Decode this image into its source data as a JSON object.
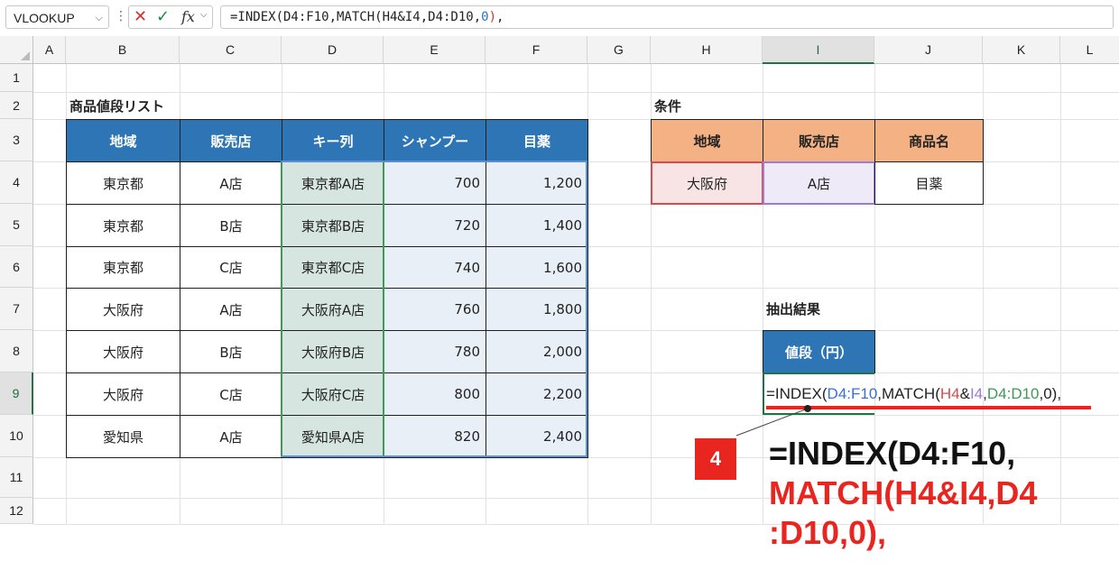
{
  "formula_bar": {
    "name_box": "VLOOKUP",
    "cancel_icon": "✕",
    "enter_icon": "✓",
    "fx_label": "fx",
    "formula_black": "=INDEX(D4:F10,MATCH(H4&I4,D4:D10,",
    "formula_blue": "0",
    "formula_red": ")",
    "formula_tail": ","
  },
  "columns": [
    "A",
    "B",
    "C",
    "D",
    "E",
    "F",
    "G",
    "H",
    "I",
    "J",
    "K",
    "L"
  ],
  "rows": [
    "1",
    "2",
    "3",
    "4",
    "5",
    "6",
    "7",
    "8",
    "9",
    "10",
    "11",
    "12"
  ],
  "product_list": {
    "title": "商品値段リスト",
    "headers": [
      "地域",
      "販売店",
      "キー列",
      "シャンプー",
      "目薬"
    ],
    "rows": [
      [
        "東京都",
        "A店",
        "東京都A店",
        "700",
        "1,200"
      ],
      [
        "東京都",
        "B店",
        "東京都B店",
        "720",
        "1,400"
      ],
      [
        "東京都",
        "C店",
        "東京都C店",
        "740",
        "1,600"
      ],
      [
        "大阪府",
        "A店",
        "大阪府A店",
        "760",
        "1,800"
      ],
      [
        "大阪府",
        "B店",
        "大阪府B店",
        "780",
        "2,000"
      ],
      [
        "大阪府",
        "C店",
        "大阪府C店",
        "800",
        "2,200"
      ],
      [
        "愛知県",
        "A店",
        "愛知県A店",
        "820",
        "2,400"
      ]
    ]
  },
  "conditions": {
    "title": "条件",
    "headers": [
      "地域",
      "販売店",
      "商品名"
    ],
    "values": [
      "大阪府",
      "A店",
      "目薬"
    ]
  },
  "result": {
    "title": "抽出結果",
    "header": "値段（円）",
    "formula_parts": {
      "p1": "=INDEX(",
      "p2": "D4:F10",
      "p3": ",MATCH(",
      "p4": "H4",
      "p5": "&",
      "p6": "I4",
      "p7": ",",
      "p8": "D4:D10",
      "p9": ",0),"
    }
  },
  "annotation": {
    "step": "4",
    "line1": "=INDEX(D4:F10,",
    "line2": "MATCH(H4&I4,D4",
    "line3": ":D10,0),"
  },
  "colors": {
    "table_header": "#2e75b6",
    "cond_header": "#f4b183",
    "accent_red": "#e8251f",
    "excel_green": "#217346"
  }
}
